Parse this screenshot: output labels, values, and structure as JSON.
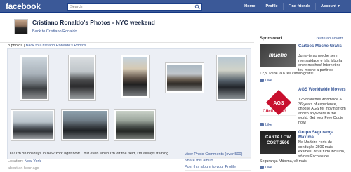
{
  "topbar": {
    "logo": "facebook",
    "search_placeholder": "Search",
    "nav": [
      "Home",
      "Profile",
      "Find friends",
      "Account"
    ]
  },
  "header": {
    "title": "Cristiano Ronaldo's Photos - NYC weekend",
    "back_link": "Back to Cristiano Ronaldo"
  },
  "album": {
    "count_text": "8 photos",
    "separator": " | ",
    "back_link": "Back to Cristiano Ronaldo's Photos",
    "photos": [
      "photo",
      "photo",
      "photo",
      "photo",
      "photo",
      "photo",
      "photo",
      "photo"
    ]
  },
  "caption": {
    "text": "Olá! I'm on holidays in New York right now....but even when I'm off the field, I'm always training.....",
    "location_label": "Location:",
    "location_value": "New York",
    "timestamp": "about an hour ago"
  },
  "actions": [
    "View Photo Comments (over 500)",
    "Share this album",
    "Post this album to your Profile"
  ],
  "sponsored": {
    "heading": "Sponsored",
    "create_ad": "Create an advert",
    "ads": [
      {
        "image_text": "mucho moche",
        "title": "Cartões Moche Grátis",
        "body": "Junta-te ao moche sem mensalidade e fala à borla entre moches! Internet no teu moche a partir de",
        "extra": "€2,5. Pede já o teu cartão grátis!",
        "like": "Like"
      },
      {
        "image_text": "AGS",
        "image_subtext": "Click here!",
        "title": "AGS Worldwide Movers",
        "body": "125 branches worldwide & 36 years of experience, choose AGS for moving from and to anywhere in the world. Get your Free Quote now!",
        "like": "Like"
      },
      {
        "image_text": "CARTA LOW COST 250€",
        "title": "Grupo Segurança Máxima",
        "body": "Na Madeira carta de condução 250€ mais exames, 369€ tudo incluído, só nas Escolas de",
        "extra": "Segurança Máxima, vê mais.",
        "like": "Like"
      }
    ]
  }
}
